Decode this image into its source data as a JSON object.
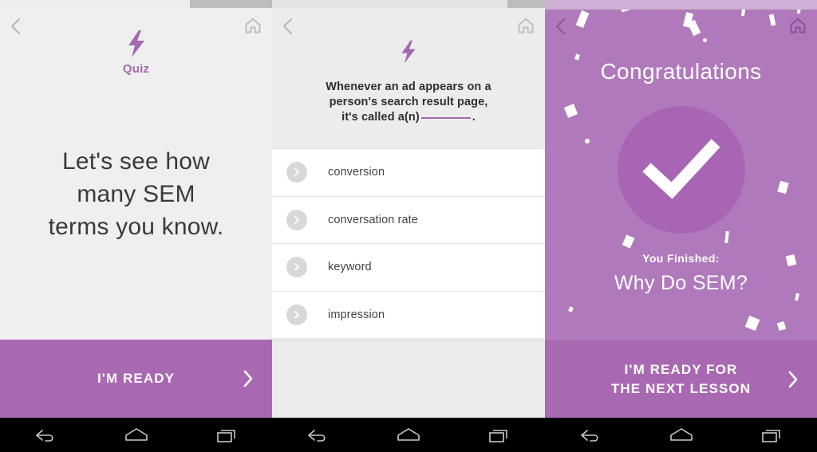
{
  "colors": {
    "accent_purple": "#a569b0",
    "cta_purple": "#a969b2",
    "celebrate_purple": "#b079bb",
    "circle_purple": "#a765b3",
    "light_gray_bg": "#f0efef",
    "option_gray": "#d8d8d8",
    "navbar_black": "#000000"
  },
  "screens": [
    {
      "id": "quiz-intro",
      "header": {
        "back_icon": "chevron-left-icon",
        "home_icon": "home-icon"
      },
      "badge": {
        "icon": "lightning-bolt-icon",
        "label": "Quiz"
      },
      "headline_lines": [
        "Let's see how",
        "many SEM",
        "terms you know."
      ],
      "cta": {
        "label": "I'M READY",
        "icon": "chevron-right-icon"
      }
    },
    {
      "id": "quiz-question",
      "header": {
        "back_icon": "chevron-left-icon",
        "home_icon": "home-icon"
      },
      "badge": {
        "icon": "lightning-bolt-icon"
      },
      "question": {
        "line1": "Whenever an ad appears on a",
        "line2": "person's search result page,",
        "line3_prefix": "it's called a(n)",
        "line3_suffix": "."
      },
      "options": [
        {
          "label": "conversion",
          "icon": "chevron-right-circle-icon"
        },
        {
          "label": "conversation rate",
          "icon": "chevron-right-circle-icon"
        },
        {
          "label": "keyword",
          "icon": "chevron-right-circle-icon"
        },
        {
          "label": "impression",
          "icon": "chevron-right-circle-icon"
        }
      ]
    },
    {
      "id": "lesson-complete",
      "header": {
        "back_icon": "chevron-left-icon",
        "home_icon": "home-icon"
      },
      "title": "Congratulations",
      "badge_icon": "checkmark-icon",
      "finished_label": "You Finished:",
      "lesson_title": "Why Do SEM?",
      "cta": {
        "line1": "I'M READY FOR",
        "line2": "THE NEXT LESSON",
        "icon": "chevron-right-icon"
      }
    }
  ],
  "navbar": {
    "back": "android-back-icon",
    "home": "android-home-icon",
    "recents": "android-recents-icon"
  }
}
